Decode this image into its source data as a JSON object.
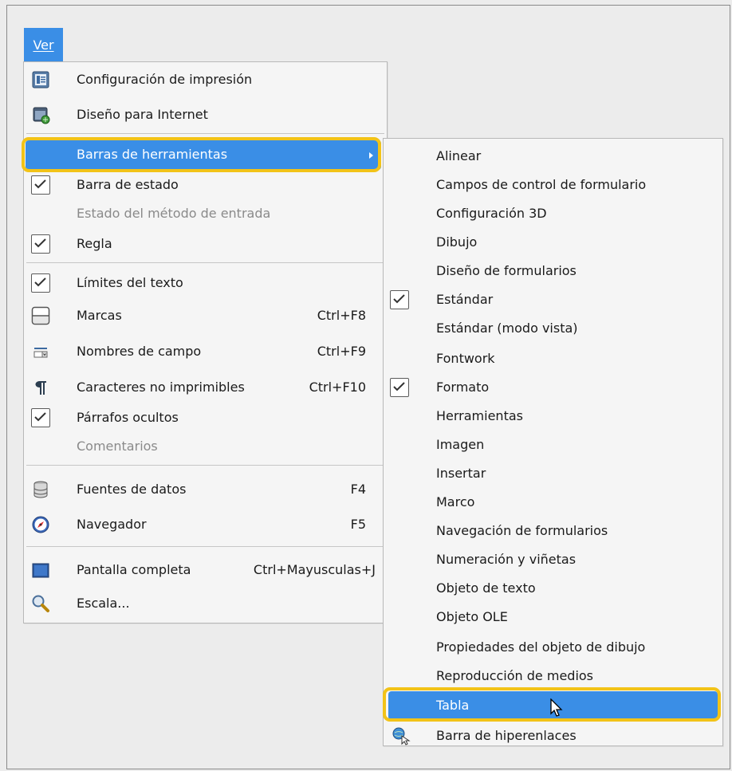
{
  "menubar": {
    "ver": "Ver"
  },
  "main_menu": [
    {
      "label": "Configuración de impresión",
      "icon": "print-layout-icon"
    },
    {
      "label": "Diseño para Internet",
      "icon": "web-layout-icon"
    },
    {
      "label": "Barras de herramientas",
      "icon": "",
      "submenu": true,
      "highlighted": true
    },
    {
      "label": "Barra de estado",
      "checked": true
    },
    {
      "label": "Estado del método de entrada",
      "disabled": true
    },
    {
      "label": "Regla",
      "checked": true
    },
    {
      "label": "Límites del texto",
      "checked": true
    },
    {
      "label": "Marcas",
      "shortcut": "Ctrl+F8",
      "icon": "field-shadings-icon"
    },
    {
      "label": "Nombres de campo",
      "shortcut": "Ctrl+F9",
      "icon": "field-names-icon"
    },
    {
      "label": "Caracteres no imprimibles",
      "shortcut": "Ctrl+F10",
      "icon": "pilcrow-icon"
    },
    {
      "label": "Párrafos ocultos",
      "checked": true
    },
    {
      "label": "Comentarios",
      "disabled": true
    },
    {
      "label": "Fuentes de datos",
      "shortcut": "F4",
      "icon": "database-icon"
    },
    {
      "label": "Navegador",
      "shortcut": "F5",
      "icon": "compass-icon"
    },
    {
      "label": "Pantalla completa",
      "shortcut": "Ctrl+Mayusculas+J",
      "icon": "fullscreen-icon"
    },
    {
      "label": "Escala...",
      "icon": "zoom-icon"
    }
  ],
  "sub_menu": [
    {
      "label": "Alinear"
    },
    {
      "label": "Campos de control de formulario"
    },
    {
      "label": "Configuración 3D"
    },
    {
      "label": "Dibujo"
    },
    {
      "label": "Diseño de formularios"
    },
    {
      "label": "Estándar",
      "checked": true
    },
    {
      "label": "Estándar (modo vista)"
    },
    {
      "label": "Fontwork"
    },
    {
      "label": "Formato",
      "checked": true
    },
    {
      "label": "Herramientas"
    },
    {
      "label": "Imagen"
    },
    {
      "label": "Insertar"
    },
    {
      "label": "Marco"
    },
    {
      "label": "Navegación de formularios"
    },
    {
      "label": "Numeración y viñetas"
    },
    {
      "label": "Objeto de texto"
    },
    {
      "label": "Objeto OLE"
    },
    {
      "label": "Propiedades del objeto de dibujo"
    },
    {
      "label": "Reproducción de medios"
    },
    {
      "label": "Tabla",
      "highlighted": true
    },
    {
      "label": "Barra de hiperenlaces",
      "icon": "hyperlink-bar-icon"
    }
  ],
  "colors": {
    "highlight": "#3a8ee6",
    "ring": "#f2c318"
  }
}
